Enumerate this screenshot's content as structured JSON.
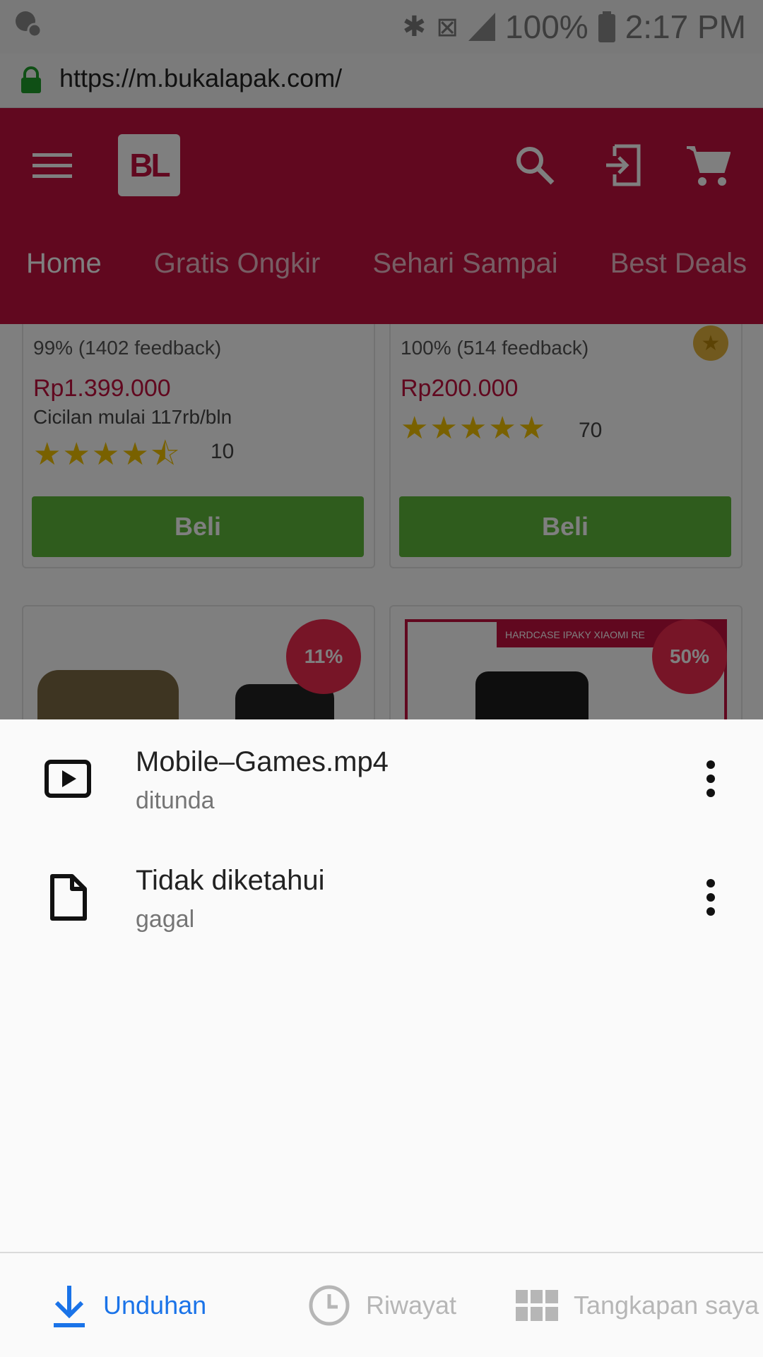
{
  "status_bar": {
    "battery": "100%",
    "time": "2:17 PM"
  },
  "browser": {
    "url": "https://m.bukalapak.com/"
  },
  "app": {
    "logo": "BL",
    "tabs": [
      "Home",
      "Gratis Ongkir",
      "Sehari Sampai",
      "Best Deals"
    ]
  },
  "products": [
    {
      "feedback": "99% (1402 feedback)",
      "price": "Rp1.399.000",
      "installment": "Cicilan mulai 117rb/bln",
      "rating_stars": 4.5,
      "review_count": "10",
      "buy_label": "Beli"
    },
    {
      "feedback": "100% (514 feedback)",
      "price": "Rp200.000",
      "installment": "",
      "rating_stars": 5,
      "review_count": "70",
      "buy_label": "Beli"
    }
  ],
  "product_images": [
    {
      "discount": "11%"
    },
    {
      "discount": "50%",
      "banner_text": "HARDCASE IPAKY XIAOMI RE"
    }
  ],
  "downloads": [
    {
      "name": "Mobile–Games.mp4",
      "status": "ditunda",
      "icon": "video-file-icon"
    },
    {
      "name": "Tidak diketahui",
      "status": "gagal",
      "icon": "file-icon"
    }
  ],
  "bottom_nav": {
    "downloads": "Unduhan",
    "history": "Riwayat",
    "screenshots": "Tangkapan saya"
  },
  "colors": {
    "brand": "#c3103f",
    "buy": "#5fb83a",
    "accent": "#1a73e8",
    "discount": "#ee2a4f"
  }
}
